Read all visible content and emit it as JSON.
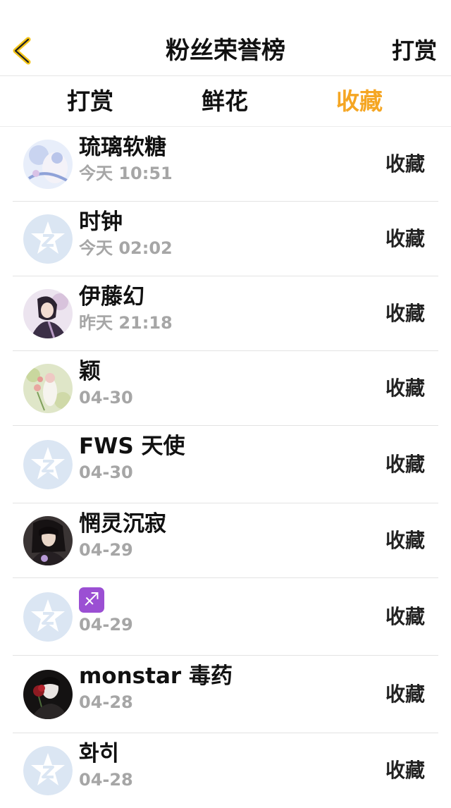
{
  "header": {
    "title": "粉丝荣誉榜",
    "right_label": "打赏"
  },
  "tabs": [
    {
      "label": "打赏",
      "active": false
    },
    {
      "label": "鲜花",
      "active": false
    },
    {
      "label": "收藏",
      "active": true
    }
  ],
  "colors": {
    "accent": "#f5a623",
    "text": "#111111",
    "secondary": "#a6a6a6",
    "divider": "#e3e3e3",
    "default_avatar_bg": "#dbe6f3",
    "default_avatar_mark": "#ffffff"
  },
  "rows": [
    {
      "name": "琉璃软糖",
      "time": "今天 10:51",
      "action": "收藏",
      "avatar": "photo-avatar-pastel"
    },
    {
      "name": "时钟",
      "time": "今天 02:02",
      "action": "收藏",
      "avatar": "default-avatar"
    },
    {
      "name": "伊藤幻",
      "time": "昨天 21:18",
      "action": "收藏",
      "avatar": "photo-avatar-anime"
    },
    {
      "name": "颖",
      "time": "04-30",
      "action": "收藏",
      "avatar": "photo-avatar-flowers"
    },
    {
      "name": "FWS 天使",
      "time": "04-30",
      "action": "收藏",
      "avatar": "default-avatar"
    },
    {
      "name": "惘灵沉寂",
      "time": "04-29",
      "action": "收藏",
      "avatar": "photo-avatar-dark"
    },
    {
      "name": "♐",
      "time": "04-29",
      "action": "收藏",
      "avatar": "default-avatar"
    },
    {
      "name": "monstar 毒药",
      "time": "04-28",
      "action": "收藏",
      "avatar": "photo-avatar-rose"
    },
    {
      "name": "화히",
      "time": "04-28",
      "action": "收藏",
      "avatar": "default-avatar"
    }
  ]
}
